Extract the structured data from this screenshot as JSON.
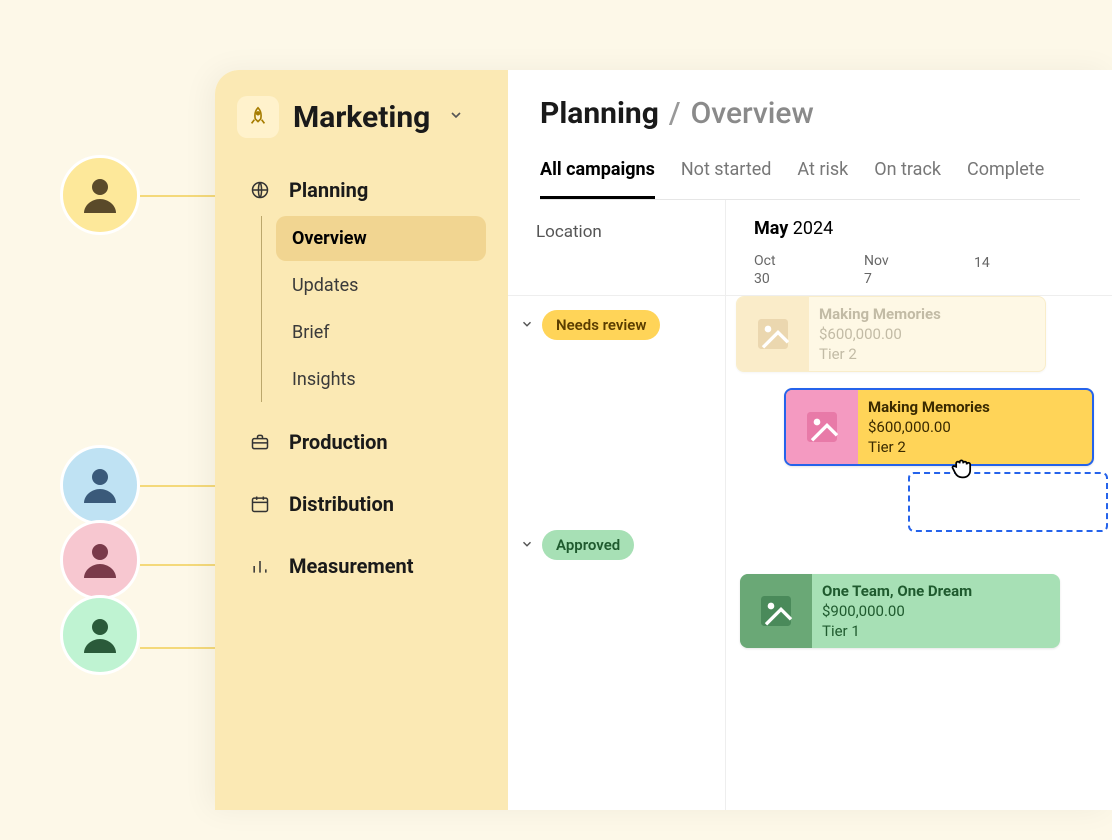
{
  "workspace": {
    "name": "Marketing"
  },
  "sidebar": {
    "sections": [
      {
        "icon": "globe-icon",
        "label": "Planning",
        "active": true,
        "children": [
          {
            "label": "Overview",
            "active": true
          },
          {
            "label": "Updates"
          },
          {
            "label": "Brief"
          },
          {
            "label": "Insights"
          }
        ]
      },
      {
        "icon": "briefcase-icon",
        "label": "Production"
      },
      {
        "icon": "calendar-icon",
        "label": "Distribution"
      },
      {
        "icon": "bars-icon",
        "label": "Measurement"
      }
    ]
  },
  "breadcrumb": {
    "first": "Planning",
    "sep": "/",
    "last": "Overview"
  },
  "tabs": [
    {
      "label": "All campaigns",
      "active": true
    },
    {
      "label": "Not started"
    },
    {
      "label": "At risk"
    },
    {
      "label": "On track"
    },
    {
      "label": "Complete"
    }
  ],
  "timeline": {
    "location_label": "Location",
    "month": "May",
    "year": "2024",
    "subdates": [
      {
        "month": "Oct",
        "day": "30"
      },
      {
        "month": "Nov",
        "day": "7"
      },
      {
        "month": "",
        "day": "14"
      }
    ]
  },
  "groups": [
    {
      "name": "Needs review",
      "color": "yellow"
    },
    {
      "name": "Approved",
      "color": "green"
    }
  ],
  "cards": {
    "ghost": {
      "title": "Making Memories",
      "amount": "$600,000.00",
      "tier": "Tier 2"
    },
    "active": {
      "title": "Making Memories",
      "amount": "$600,000.00",
      "tier": "Tier 2"
    },
    "green": {
      "title": "One Team, One Dream",
      "amount": "$900,000.00",
      "tier": "Tier 1"
    }
  },
  "avatar_names": [
    "avatar-1",
    "avatar-2",
    "avatar-3",
    "avatar-4"
  ]
}
